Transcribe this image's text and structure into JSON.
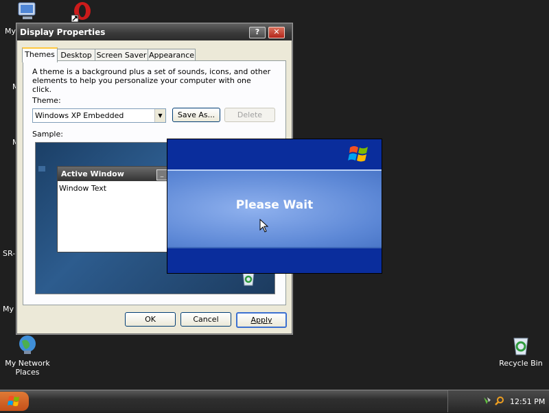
{
  "desktop": {
    "icons": [
      {
        "label": "My Network Places"
      },
      {
        "label": "Recycle Bin"
      }
    ],
    "partial_labels": [
      "My",
      "M",
      "M",
      "SR-",
      "My"
    ]
  },
  "dialog": {
    "title": "Display Properties",
    "help_label": "?",
    "close_label": "✕",
    "tabs": [
      "Themes",
      "Desktop",
      "Screen Saver",
      "Appearance"
    ],
    "description": "A theme is a background plus a set of sounds, icons, and other elements to help you personalize your computer with one click.",
    "theme_label": "Theme:",
    "theme_value": "Windows XP Embedded",
    "save_as_label": "Save As...",
    "delete_label": "Delete",
    "sample_label": "Sample:",
    "sample": {
      "window_title": "Active Window",
      "window_text": "Window Text"
    },
    "ok_label": "OK",
    "cancel_label": "Cancel",
    "apply_label": "Apply"
  },
  "splash": {
    "text": "Please Wait"
  },
  "taskbar": {
    "clock": "12:51 PM"
  }
}
